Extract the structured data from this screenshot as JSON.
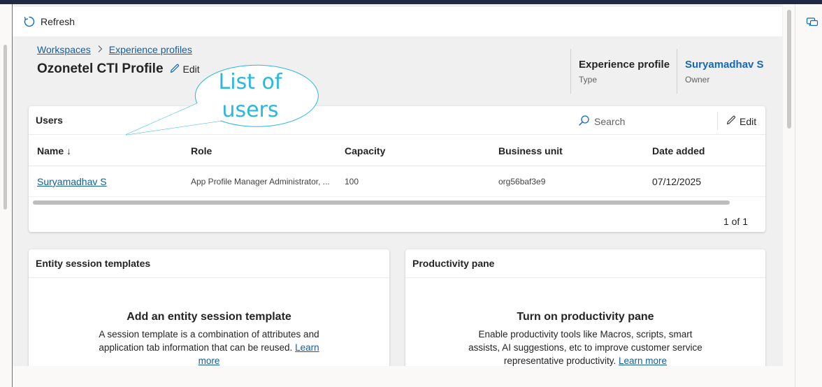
{
  "commandbar": {
    "refresh_label": "Refresh"
  },
  "breadcrumb": {
    "items": [
      "Workspaces",
      "Experience profiles"
    ]
  },
  "header": {
    "title": "Ozonetel CTI Profile",
    "edit_label": "Edit",
    "meta": [
      {
        "value": "Experience profile",
        "label": "Type"
      },
      {
        "value": "Suryamadhav S",
        "label": "Owner"
      }
    ]
  },
  "annotation": {
    "text": "List of users"
  },
  "users": {
    "title": "Users",
    "search_placeholder": "Search",
    "edit_label": "Edit",
    "columns": [
      "Name ↓",
      "Role",
      "Capacity",
      "Business unit",
      "Date added"
    ],
    "rows": [
      {
        "name": "Suryamadhav S",
        "role": "App Profile Manager Administrator, ...",
        "capacity": "100",
        "business_unit": "org56baf3e9",
        "date_added": "07/12/2025"
      }
    ],
    "pager": "1 of 1"
  },
  "entity_templates": {
    "title": "Entity session templates",
    "empty_title": "Add an entity session template",
    "empty_body": "A session template is a combination of attributes and application tab information that can be reused.",
    "link": "Learn more"
  },
  "productivity": {
    "title": "Productivity pane",
    "empty_title": "Turn on productivity pane",
    "empty_body": "Enable productivity tools like Macros, scripts, smart assists, AI suggestions, etc to improve customer service representative productivity.",
    "link": "Learn more"
  },
  "colors": {
    "link": "#115ea3",
    "owner_link": "#1667b8",
    "annotation": "#2ab8dc",
    "top_strip": "#1f2a44"
  }
}
